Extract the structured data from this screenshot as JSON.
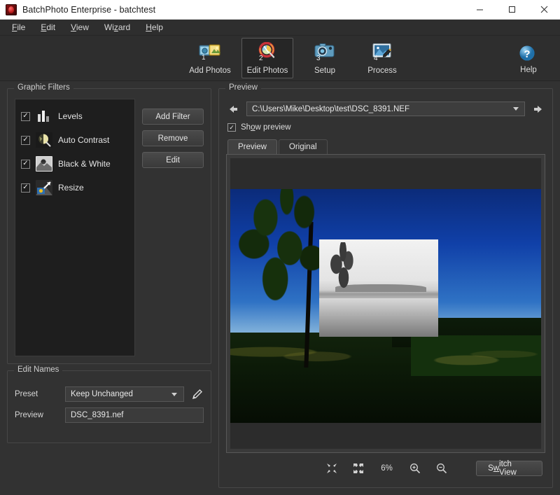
{
  "window": {
    "title": "BatchPhoto Enterprise - batchtest",
    "app_icon": "batchphoto-logo-icon",
    "controls": {
      "minimize": "minimize-icon",
      "maximize": "maximize-icon",
      "close": "close-icon"
    }
  },
  "menubar": {
    "items": [
      {
        "label": "File",
        "mnemonic": "F"
      },
      {
        "label": "Edit",
        "mnemonic": "E"
      },
      {
        "label": "View",
        "mnemonic": "V"
      },
      {
        "label": "Wizard",
        "mnemonic": "z"
      },
      {
        "label": "Help",
        "mnemonic": "H"
      }
    ]
  },
  "toolbar": {
    "items": [
      {
        "label": "Add Photos",
        "step": "1",
        "icon": "add-photos-icon",
        "active": false
      },
      {
        "label": "Edit Photos",
        "step": "2",
        "icon": "edit-photos-icon",
        "active": true
      },
      {
        "label": "Setup",
        "step": "3",
        "icon": "setup-icon",
        "active": false
      },
      {
        "label": "Process",
        "step": "4",
        "icon": "process-icon",
        "active": false
      }
    ],
    "help": {
      "label": "Help",
      "icon": "help-icon"
    }
  },
  "graphic_filters": {
    "group_label": "Graphic Filters",
    "filters": [
      {
        "label": "Levels",
        "checked": true,
        "check_mark": "✓",
        "icon": "levels-icon"
      },
      {
        "label": "Auto Contrast",
        "checked": true,
        "check_mark": "✓",
        "icon": "auto-contrast-icon"
      },
      {
        "label": "Black & White",
        "checked": true,
        "check_mark": "✓",
        "icon": "black-and-white-icon"
      },
      {
        "label": "Resize",
        "checked": true,
        "check_mark": "✓",
        "icon": "resize-icon"
      }
    ],
    "buttons": {
      "add_filter": "Add Filter",
      "remove": "Remove",
      "edit": "Edit"
    }
  },
  "edit_names": {
    "group_label": "Edit Names",
    "preset_label": "Preset",
    "preset_value": "Keep Unchanged",
    "preview_label": "Preview",
    "preview_value": "DSC_8391.nef",
    "edit_pencil_icon": "pencil-icon"
  },
  "preview": {
    "group_label": "Preview",
    "back_icon": "arrow-left-icon",
    "forward_icon": "arrow-right-icon",
    "path_value": "C:\\Users\\Mike\\Desktop\\test\\DSC_8391.NEF",
    "dropdown_icon": "chevron-down-icon",
    "show_preview_label": "Show preview",
    "show_preview_checked": true,
    "check_mark": "✓",
    "tabs": [
      {
        "label": "Preview",
        "selected": true
      },
      {
        "label": "Original",
        "selected": false
      }
    ],
    "zoom_toolbar": {
      "fit_icon": "fit-to-window-icon",
      "actual_size_icon": "expand-icon",
      "zoom_level": "6%",
      "zoom_in_icon": "zoom-in-icon",
      "zoom_out_icon": "zoom-out-icon",
      "switch_view_label": "Switch View",
      "switch_view_mnemonic": "i"
    },
    "image": {
      "description": "Dark landscape photo with tree silhouette, deep blue sky and field; grayscale inset overlay showing black-and-white filtered region",
      "file": "DSC_8391.NEF"
    }
  },
  "colors": {
    "window_bg": "#323232",
    "panel_bg": "#2e2e2e",
    "list_bg": "#1e1e1e",
    "title_bar": "#ffffff",
    "text": "#e4e4e4",
    "border": "#474747"
  }
}
